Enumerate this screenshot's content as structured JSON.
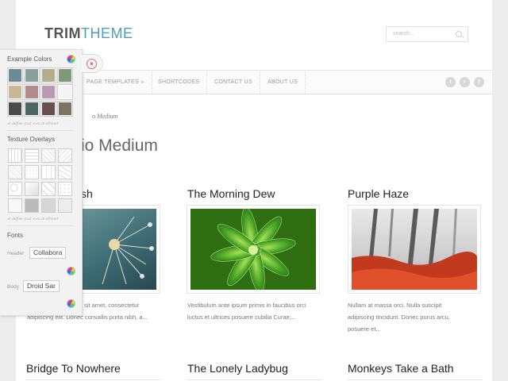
{
  "header": {
    "logo_part1": "TRIM",
    "logo_part2": "THEME",
    "search_placeholder": "search..."
  },
  "nav": {
    "items": [
      "PAGE TEMPLATES »",
      "SHORTCODES",
      "CONTACT US",
      "ABOUT US"
    ],
    "social": [
      "twitter-icon",
      "rss-icon",
      "facebook-icon"
    ]
  },
  "breadcrumb": "o Medium",
  "page_title": "io Medium",
  "posts": [
    {
      "title": "sh",
      "excerpt_line1": "sit amet, consectetur",
      "excerpt_line2": "adipiscing elit. Donec convallis porta nibh, a..."
    },
    {
      "title": "The Morning Dew",
      "excerpt_line1": "Vestibulum ante ipsum primis in faucibus orci",
      "excerpt_line2": "luctus et ultrices posuere cubilia Curae;..."
    },
    {
      "title": "Purple Haze",
      "excerpt_line1": "Nullam at massa orci. Nulla suscipit",
      "excerpt_line2": "adipiscing tincidunt. Donec purus arcu,",
      "excerpt_line3": "posuere et..."
    }
  ],
  "posts_row2": [
    "Bridge To Nowhere",
    "The Lonely Ladybug",
    "Monkeys Take a Bath"
  ],
  "epanel": {
    "example_colors": "Example Colors",
    "texture_overlays": "Texture Overlays",
    "define_note": "or define your own in ePanel",
    "fonts": "Fonts",
    "header_label": "Header",
    "header_font": "Collabora",
    "body_label": "Body",
    "body_font": "Droid Sar",
    "swatches": [
      "#6a8a95",
      "#8a9e9a",
      "#b2ae8a",
      "#7f9a7a",
      "#c8b696",
      "#b28a8e",
      "#b79ab0",
      "#f4f4f4",
      "#4a4a4a",
      "#4e6664",
      "#6a4e4e",
      "#7a7460"
    ]
  },
  "close_symbol": "×"
}
